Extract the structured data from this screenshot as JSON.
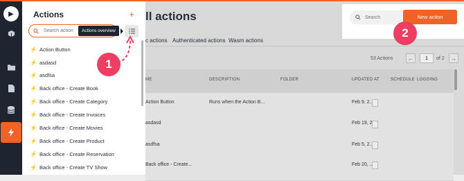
{
  "colors": {
    "accent": "#f06225",
    "callout": "#ee3f62",
    "rail": "#1e2430"
  },
  "rail": {
    "icons": [
      "play-icon",
      "cube-icon",
      "folder-bolt-icon",
      "file-icon",
      "database-icon",
      "lightning-icon"
    ]
  },
  "panel": {
    "title": "Actions",
    "add_label": "+",
    "search_placeholder": "Search action",
    "overview_tooltip": "Actions overview",
    "items": [
      "Action Button",
      "asdasd",
      "asdfsa",
      "Back office - Create Book",
      "Back office - Create Category",
      "Back office - Create Invoices",
      "Back office - Create Movies",
      "Back office - Create Product",
      "Back office - Create Reservation",
      "Back office - Create TV Show"
    ]
  },
  "main": {
    "title": "All actions",
    "title_visible": "ll actions",
    "tabs": [
      "c actions",
      "Authenticated actions",
      "Wasm actions"
    ],
    "search_placeholder": "Search",
    "new_action_label": "New action",
    "count_label": "53 Actions",
    "pager": {
      "prev": "←",
      "page": "1",
      "of": "of 2",
      "next": "→"
    },
    "columns": [
      "ME",
      "DESCRIPTION",
      "FOLDER",
      "UPDATED AT",
      "SCHEDULE",
      "LOGGING"
    ],
    "rows": [
      {
        "name": "Action Button",
        "description": "Runs when the Action B...",
        "folder": "",
        "updated": "Feb 9, 2..."
      },
      {
        "name": "asdasd",
        "description": "",
        "folder": "",
        "updated": "Feb 19, 2..."
      },
      {
        "name": "asdfsa",
        "description": "",
        "folder": "",
        "updated": "Feb 5, 2..."
      },
      {
        "name": "Back office - Create...",
        "description": "",
        "folder": "",
        "updated": "Feb 20, ..."
      }
    ]
  },
  "callouts": {
    "one": "1",
    "two": "2"
  }
}
